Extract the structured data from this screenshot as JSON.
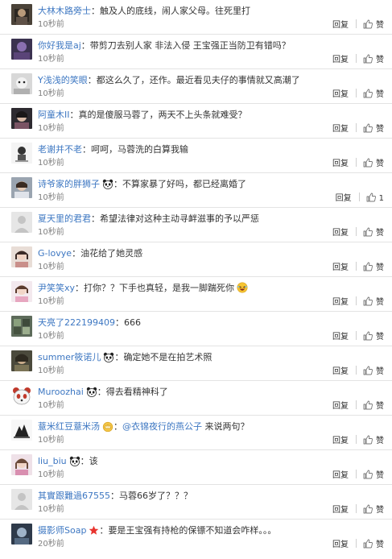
{
  "actions": {
    "reply_label": "回复",
    "like_label": "赞"
  },
  "comments": [
    {
      "user": "大林木路旁士",
      "colon": "：",
      "text": "触及人的底线，闹人家父母。往死里打",
      "time": "10秒前",
      "likes": "赞"
    },
    {
      "user": "你好我是aj",
      "colon": "：",
      "text": "带剪刀去别人家 非法入侵 王宝强正当防卫有错吗？",
      "time": "10秒前",
      "likes": "赞"
    },
    {
      "user": "Y浅浅的笑眼",
      "colon": "：",
      "text": "都这么久了，还作。最近看见夫仔的事情就又高潮了",
      "time": "10秒前",
      "likes": "赞"
    },
    {
      "user": "阿童木II",
      "colon": "：",
      "text": "真的是傻服马蓉了，两天不上头条就难受？",
      "time": "10秒前",
      "likes": "赞"
    },
    {
      "user": "老谢并不老",
      "colon": "：",
      "text": "呵呵，马蓉洗的白算我输",
      "time": "10秒前",
      "likes": "赞"
    },
    {
      "user": "诗爷家的胖狮子",
      "colon": "：",
      "text": "不算家暴了好吗，都已经离婚了",
      "time": "10秒前",
      "likes": "1"
    },
    {
      "user": "夏天里的君君",
      "colon": "：",
      "text": "希望法律对这种主动寻衅滋事的予以严惩",
      "time": "10秒前",
      "likes": "赞"
    },
    {
      "user": "G-lovye",
      "colon": "：",
      "text": "油花给了她灵感",
      "time": "10秒前",
      "likes": "赞"
    },
    {
      "user": "尹笑笑xy",
      "colon": "：",
      "text": "打你？？下手也真轻，是我一脚踹死你",
      "time": "10秒前",
      "likes": "赞"
    },
    {
      "user": "天亮了222199409",
      "colon": "：",
      "text": "666",
      "time": "10秒前",
      "likes": "赞"
    },
    {
      "user": "summer筱诺儿",
      "colon": "：",
      "text": "确定她不是在拍艺术照",
      "time": "10秒前",
      "likes": "赞"
    },
    {
      "user": "Muroozhai",
      "colon": "：",
      "text": "得去看精神科了",
      "time": "10秒前",
      "likes": "赞"
    },
    {
      "user": "薏米红豆薏米汤",
      "colon": "：",
      "mention": "@衣锦夜行的燕公子",
      "text": " 来说两句？",
      "time": "10秒前",
      "likes": "赞"
    },
    {
      "user": "liu_biu",
      "colon": "：",
      "text": "该",
      "time": "10秒前",
      "likes": "赞"
    },
    {
      "user": "其實跟難過67555",
      "colon": "：",
      "text": "马蓉66岁了？？？",
      "time": "10秒前",
      "likes": "赞"
    },
    {
      "user": "摄影师Soap",
      "colon": "：",
      "text": "要是王宝强有持枪的保镖不知道会咋样。。。",
      "time": "20秒前",
      "likes": "赞"
    }
  ],
  "colors": {
    "username": "#3d77c2",
    "text": "#333333",
    "time": "#808080",
    "divider": "#e3e3e3"
  }
}
